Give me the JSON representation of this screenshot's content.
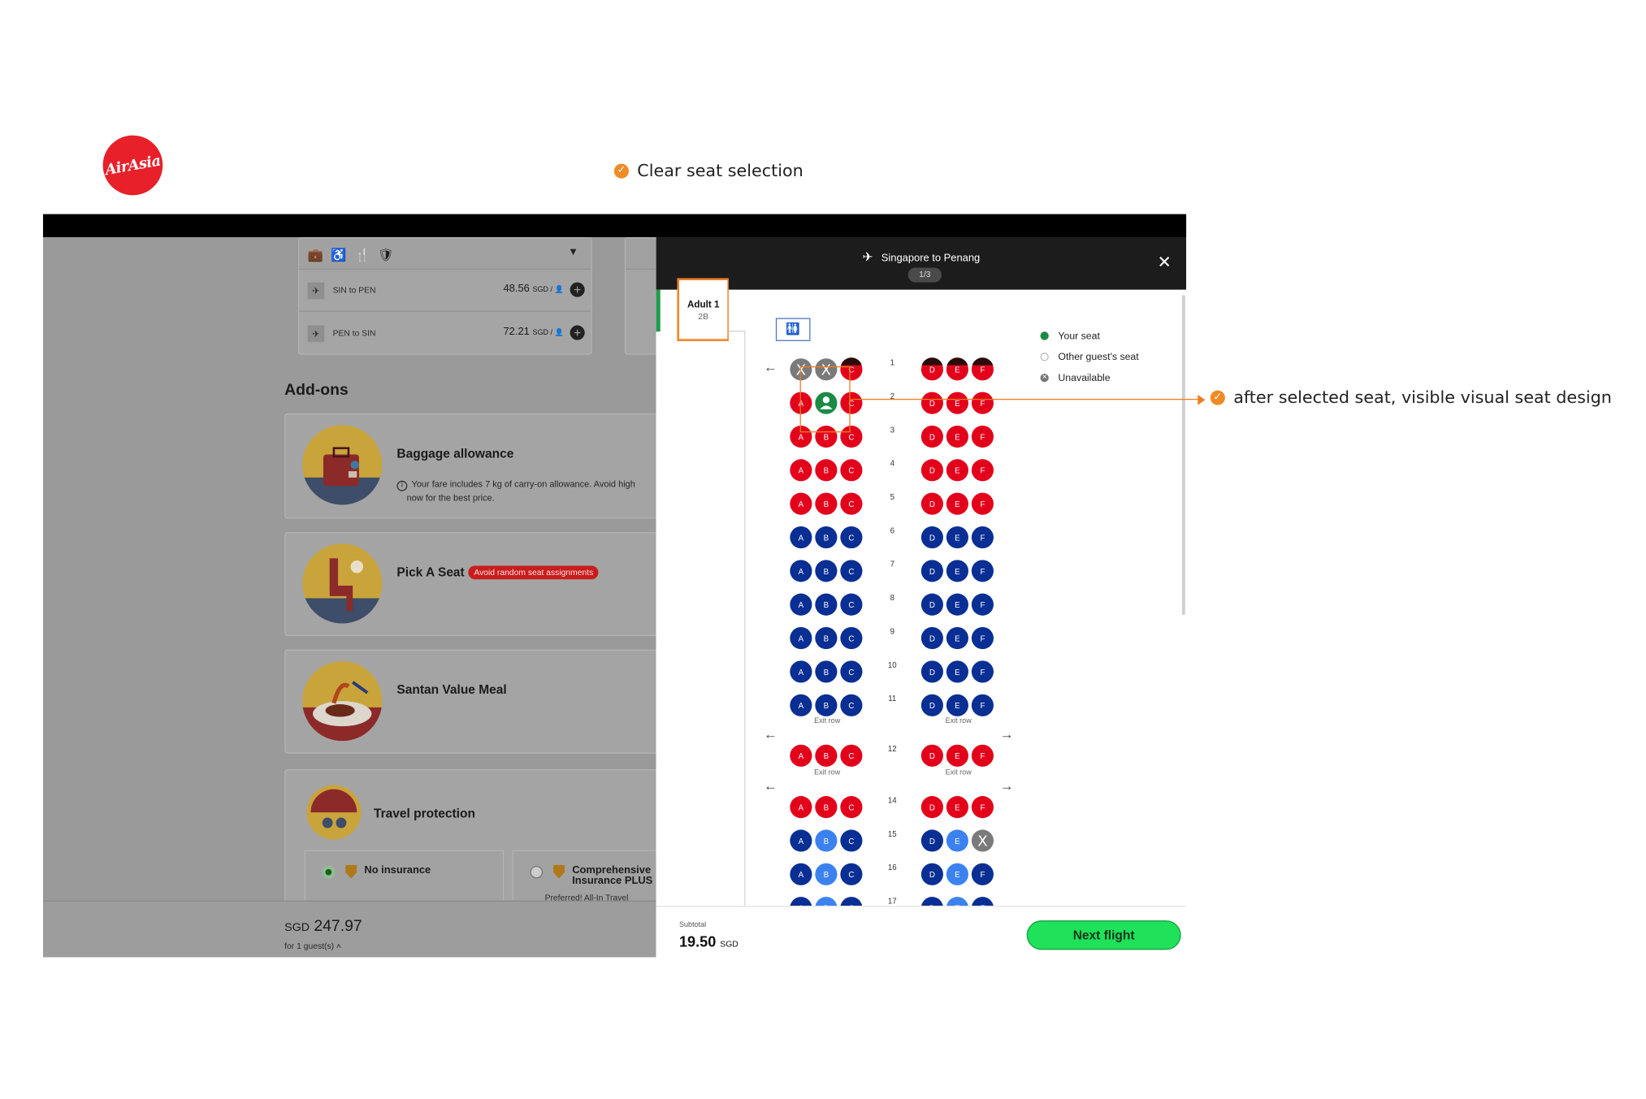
{
  "logo": {
    "text": "AirAsia",
    "color": "#e8202a"
  },
  "annotations": {
    "top": "Clear seat selection",
    "right": "after selected seat, visible visual seat design"
  },
  "background_page": {
    "bag_icons": "💼 ♿ 🍴 🛡",
    "routes": [
      {
        "name": "SIN to PEN",
        "price": "48.56",
        "currency": "SGD / 👤"
      },
      {
        "name": "PEN to SIN",
        "price": "72.21",
        "currency": "SGD / 👤"
      }
    ],
    "addons_title": "Add-ons",
    "addons": [
      {
        "title": "Baggage allowance",
        "note": "Your fare includes 7 kg of carry-on allowance. Avoid high",
        "note2": "now for the best price."
      },
      {
        "title": "Pick A Seat",
        "badge": "Avoid random seat assignments"
      },
      {
        "title": "Santan Value Meal"
      },
      {
        "title": "Travel protection"
      }
    ],
    "insurance": [
      {
        "label": "No insurance",
        "selected": true
      },
      {
        "label": "Comprehensive",
        "label2": "Insurance PLUS",
        "sub": "Preferred! All-In Travel",
        "selected": false
      }
    ],
    "total_currency": "SGD",
    "total_value": "247.97",
    "total_sub": "for 1 guest(s) ˄"
  },
  "panel": {
    "title": "Singapore to Penang",
    "pager": "1/3",
    "passenger": {
      "name": "Adult 1",
      "seat": "2B"
    },
    "legend": [
      {
        "label": "Your seat",
        "type": "your"
      },
      {
        "label": "Other guest's seat",
        "type": "other"
      },
      {
        "label": "Unavailable",
        "type": "unavailable"
      }
    ],
    "exit_row_label": "Exit row",
    "subtotal_label": "Subtotal",
    "subtotal_value": "19.50",
    "subtotal_currency": "SGD",
    "next_button": "Next flight"
  },
  "colors": {
    "premium_red": "#e3001b",
    "standard_blue": "#0a2f94",
    "light_blue": "#3b82f0",
    "unavailable": "#7a7a7a",
    "selected_green": "#1a8a46",
    "accent_orange": "#f07d1f"
  },
  "seat_rows": [
    {
      "row": "1",
      "seats": [
        [
          "A",
          "unavailable"
        ],
        [
          "B",
          "unavailable"
        ],
        [
          "C",
          "red-dark"
        ],
        [
          "D",
          "red-dark"
        ],
        [
          "E",
          "red-dark"
        ],
        [
          "F",
          "red-dark"
        ]
      ],
      "left_arrow": true
    },
    {
      "row": "2",
      "seats": [
        [
          "A",
          "red"
        ],
        [
          "B",
          "selected"
        ],
        [
          "C",
          "red"
        ],
        [
          "D",
          "red"
        ],
        [
          "E",
          "red"
        ],
        [
          "F",
          "red"
        ]
      ]
    },
    {
      "row": "3",
      "seats": [
        [
          "A",
          "red"
        ],
        [
          "B",
          "red"
        ],
        [
          "C",
          "red"
        ],
        [
          "D",
          "red"
        ],
        [
          "E",
          "red"
        ],
        [
          "F",
          "red"
        ]
      ]
    },
    {
      "row": "4",
      "seats": [
        [
          "A",
          "red"
        ],
        [
          "B",
          "red"
        ],
        [
          "C",
          "red"
        ],
        [
          "D",
          "red"
        ],
        [
          "E",
          "red"
        ],
        [
          "F",
          "red"
        ]
      ]
    },
    {
      "row": "5",
      "seats": [
        [
          "A",
          "red"
        ],
        [
          "B",
          "red"
        ],
        [
          "C",
          "red"
        ],
        [
          "D",
          "red"
        ],
        [
          "E",
          "red"
        ],
        [
          "F",
          "red"
        ]
      ]
    },
    {
      "row": "6",
      "seats": [
        [
          "A",
          "blue"
        ],
        [
          "B",
          "blue"
        ],
        [
          "C",
          "blue"
        ],
        [
          "D",
          "blue"
        ],
        [
          "E",
          "blue"
        ],
        [
          "F",
          "blue"
        ]
      ]
    },
    {
      "row": "7",
      "seats": [
        [
          "A",
          "blue"
        ],
        [
          "B",
          "blue"
        ],
        [
          "C",
          "blue"
        ],
        [
          "D",
          "blue"
        ],
        [
          "E",
          "blue"
        ],
        [
          "F",
          "blue"
        ]
      ]
    },
    {
      "row": "8",
      "seats": [
        [
          "A",
          "blue"
        ],
        [
          "B",
          "blue"
        ],
        [
          "C",
          "blue"
        ],
        [
          "D",
          "blue"
        ],
        [
          "E",
          "blue"
        ],
        [
          "F",
          "blue"
        ]
      ]
    },
    {
      "row": "9",
      "seats": [
        [
          "A",
          "blue"
        ],
        [
          "B",
          "blue"
        ],
        [
          "C",
          "blue"
        ],
        [
          "D",
          "blue"
        ],
        [
          "E",
          "blue"
        ],
        [
          "F",
          "blue"
        ]
      ]
    },
    {
      "row": "10",
      "seats": [
        [
          "A",
          "blue"
        ],
        [
          "B",
          "blue"
        ],
        [
          "C",
          "blue"
        ],
        [
          "D",
          "blue"
        ],
        [
          "E",
          "blue"
        ],
        [
          "F",
          "blue"
        ]
      ]
    },
    {
      "row": "11",
      "seats": [
        [
          "A",
          "blue"
        ],
        [
          "B",
          "blue"
        ],
        [
          "C",
          "blue"
        ],
        [
          "D",
          "blue"
        ],
        [
          "E",
          "blue"
        ],
        [
          "F",
          "blue"
        ]
      ]
    },
    {
      "row": "12",
      "seats": [
        [
          "A",
          "red"
        ],
        [
          "B",
          "red"
        ],
        [
          "C",
          "red"
        ],
        [
          "D",
          "red"
        ],
        [
          "E",
          "red"
        ],
        [
          "F",
          "red"
        ]
      ],
      "exit_before": true
    },
    {
      "row": "14",
      "seats": [
        [
          "A",
          "red"
        ],
        [
          "B",
          "red"
        ],
        [
          "C",
          "red"
        ],
        [
          "D",
          "red"
        ],
        [
          "E",
          "red"
        ],
        [
          "F",
          "red"
        ]
      ],
      "exit_before": true
    },
    {
      "row": "15",
      "seats": [
        [
          "A",
          "blue"
        ],
        [
          "B",
          "lightblue"
        ],
        [
          "C",
          "blue"
        ],
        [
          "D",
          "blue"
        ],
        [
          "E",
          "lightblue"
        ],
        [
          "F",
          "unavailable"
        ]
      ]
    },
    {
      "row": "16",
      "seats": [
        [
          "A",
          "blue"
        ],
        [
          "B",
          "lightblue"
        ],
        [
          "C",
          "blue"
        ],
        [
          "D",
          "blue"
        ],
        [
          "E",
          "lightblue"
        ],
        [
          "F",
          "blue"
        ]
      ]
    },
    {
      "row": "17",
      "seats": [
        [
          "A",
          "blue"
        ],
        [
          "B",
          "lightblue"
        ],
        [
          "C",
          "blue"
        ],
        [
          "D",
          "blue"
        ],
        [
          "E",
          "lightblue"
        ],
        [
          "F",
          "blue"
        ]
      ]
    }
  ]
}
